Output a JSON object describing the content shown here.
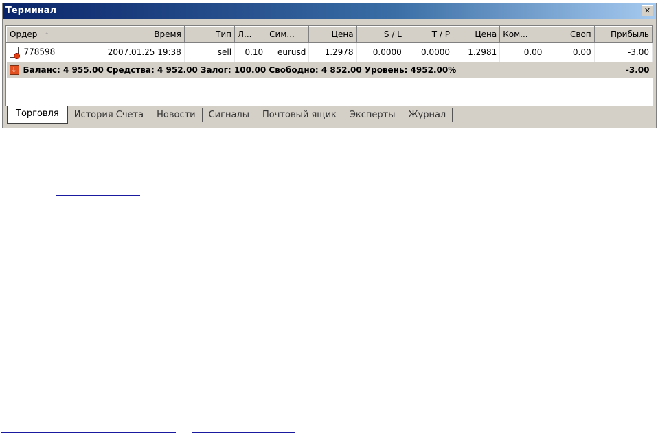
{
  "window": {
    "title": "Терминал",
    "close_glyph": "✕"
  },
  "columns": [
    "Ордер",
    "Время",
    "Тип",
    "Л...",
    "Сим...",
    "Цена",
    "S / L",
    "T / P",
    "Цена",
    "Ком...",
    "Своп",
    "Прибыль"
  ],
  "sort_indicator": "^",
  "order": {
    "id": "778598",
    "time": "2007.01.25 19:38",
    "type": "sell",
    "lots": "0.10",
    "symbol": "eurusd",
    "price": "1.2978",
    "sl": "0.0000",
    "tp": "0.0000",
    "current_price": "1.2981",
    "commission": "0.00",
    "swap": "0.00",
    "profit": "-3.00"
  },
  "summary": {
    "text": "Баланс: 4 955.00  Средства: 4 952.00  Залог: 100.00  Свободно: 4 852.00  Уровень: 4952.00%",
    "profit": "-3.00",
    "icon_glyph": "↓"
  },
  "tabs": [
    "Торговля",
    "История Счета",
    "Новости",
    "Сигналы",
    "Почтовый ящик",
    "Эксперты",
    "Журнал"
  ],
  "icons": {
    "order": "document-icon",
    "summary": "down-arrow-icon"
  }
}
